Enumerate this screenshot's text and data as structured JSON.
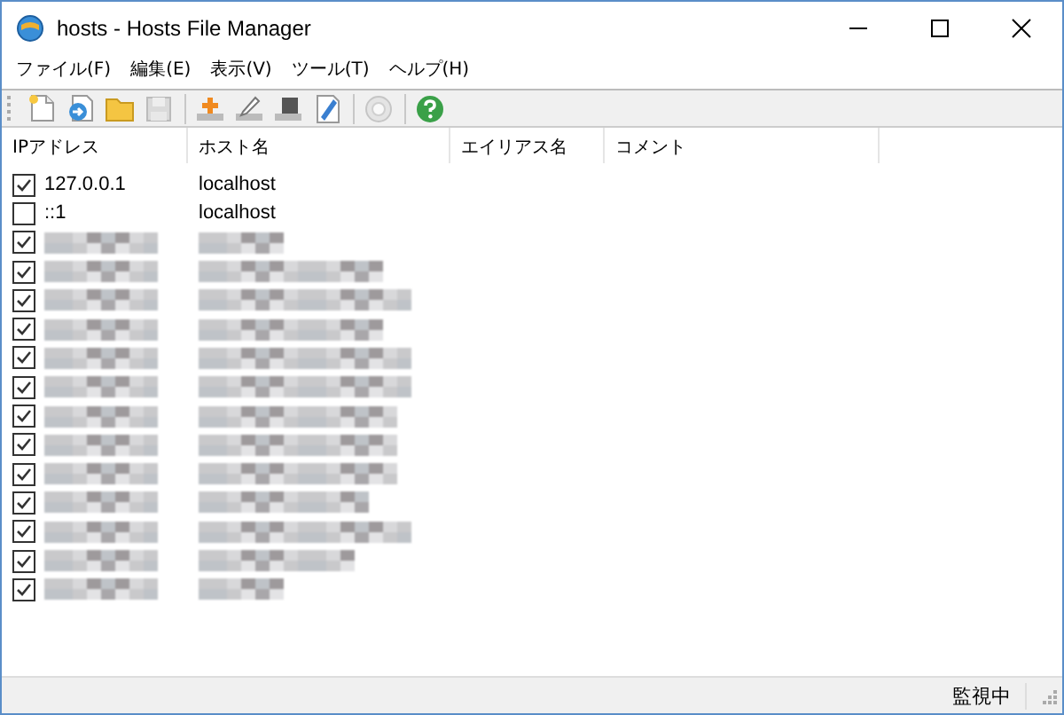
{
  "window": {
    "title": "hosts  - Hosts File Manager"
  },
  "menu": [
    "ファイル(F)",
    "編集(E)",
    "表示(V)",
    "ツール(T)",
    "ヘルプ(H)"
  ],
  "toolbar": [
    {
      "kind": "new",
      "disabled": false
    },
    {
      "kind": "import",
      "disabled": false
    },
    {
      "kind": "open",
      "disabled": false
    },
    {
      "kind": "save",
      "disabled": true
    },
    {
      "kind": "separator"
    },
    {
      "kind": "add",
      "disabled": false
    },
    {
      "kind": "edit",
      "disabled": false
    },
    {
      "kind": "delete",
      "disabled": false
    },
    {
      "kind": "notepad",
      "disabled": false
    },
    {
      "kind": "separator"
    },
    {
      "kind": "settings",
      "disabled": true
    },
    {
      "kind": "separator"
    },
    {
      "kind": "help",
      "disabled": false
    }
  ],
  "table": {
    "columns": [
      "IPアドレス",
      "ホスト名",
      "エイリアス名",
      "コメント"
    ],
    "rows": [
      {
        "kind": "text",
        "checked": true,
        "ip": "127.0.0.1",
        "host": "localhost"
      },
      {
        "kind": "text",
        "checked": false,
        "ip": "::1",
        "host": "localhost"
      },
      {
        "kind": "masked",
        "checked": true
      },
      {
        "kind": "masked",
        "checked": true
      },
      {
        "kind": "masked",
        "checked": true
      },
      {
        "kind": "masked",
        "checked": true
      },
      {
        "kind": "masked",
        "checked": true
      },
      {
        "kind": "masked",
        "checked": true
      },
      {
        "kind": "masked",
        "checked": true
      },
      {
        "kind": "masked",
        "checked": true
      },
      {
        "kind": "masked",
        "checked": true
      },
      {
        "kind": "masked",
        "checked": true
      },
      {
        "kind": "masked",
        "checked": true
      },
      {
        "kind": "masked",
        "checked": true
      },
      {
        "kind": "masked",
        "checked": true
      }
    ]
  },
  "status_bar": {
    "text": "監視中"
  }
}
